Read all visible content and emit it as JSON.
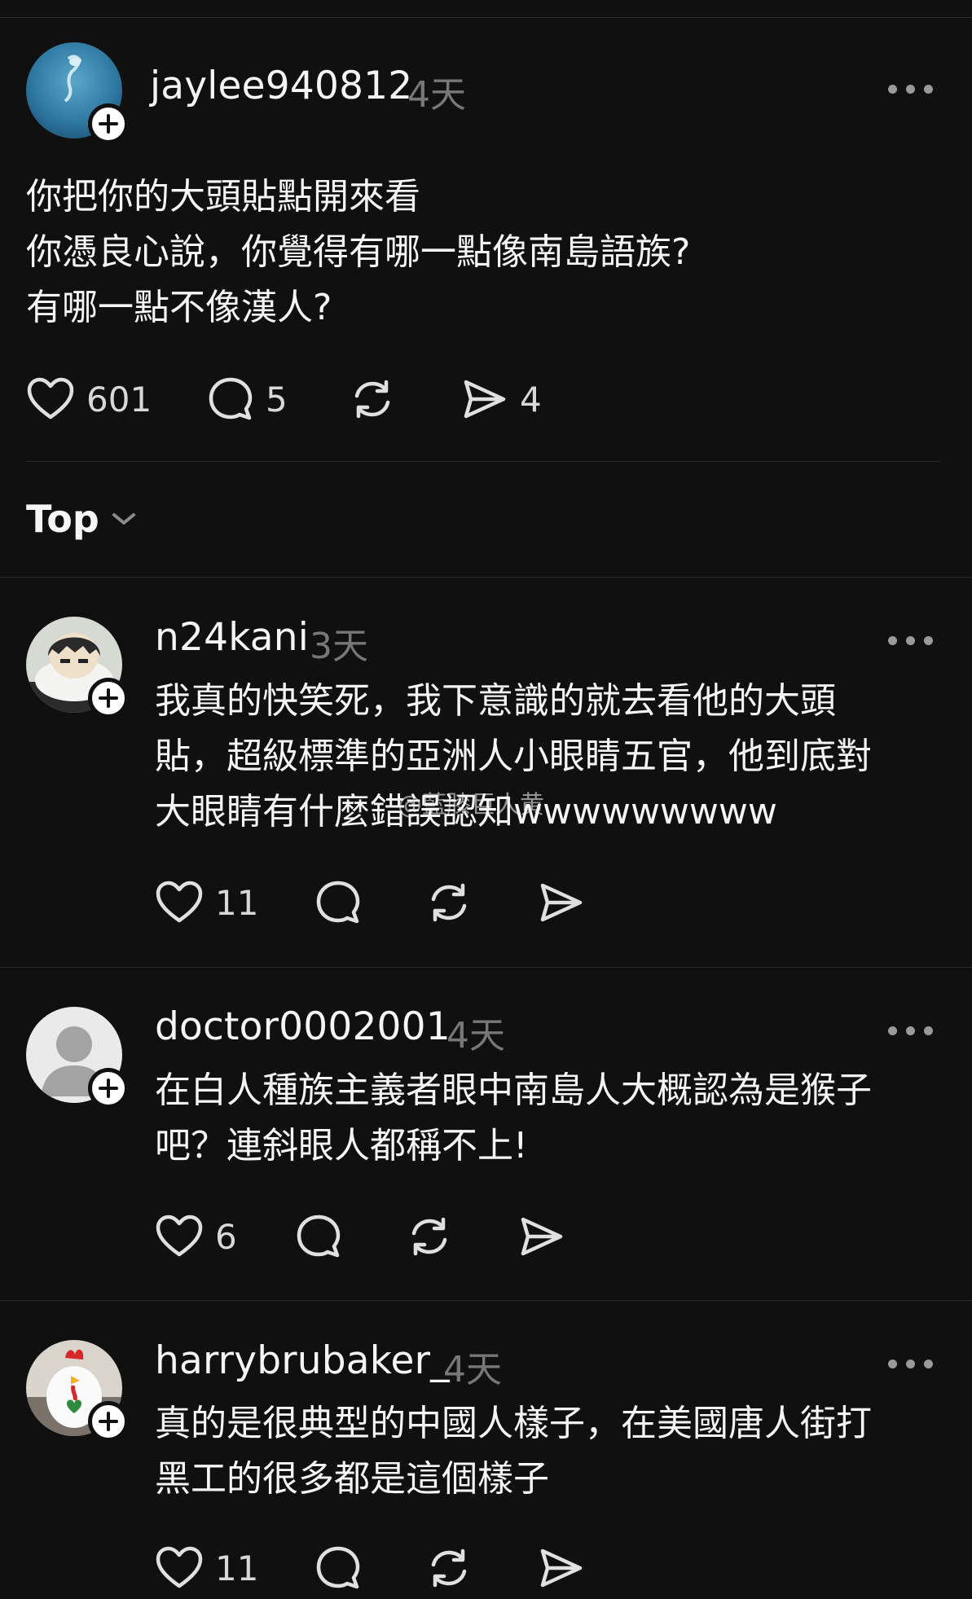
{
  "post": {
    "username": "jaylee940812",
    "time": "4天",
    "lines": [
      "你把你的大頭貼點開來看",
      "你憑良心說，你覺得有哪一點像南島語族?",
      "有哪一點不像漢人?"
    ],
    "likes": "601",
    "comments": "5",
    "shares": "4"
  },
  "sort": {
    "label": "Top"
  },
  "watermark": "@藍膝巨人黄",
  "replies": [
    {
      "username": "n24kani",
      "time": "3天",
      "lines": [
        "我真的快笑死，我下意識的就去看他的大頭",
        "貼，超級標準的亞洲人小眼睛五官，他到底對",
        "大眼睛有什麼錯誤認知wwwwwwwww"
      ],
      "likes": "11"
    },
    {
      "username": "doctor0002001",
      "time": "4天",
      "lines": [
        "在白人種族主義者眼中南島人大概認為是猴子",
        "吧？連斜眼人都稱不上!"
      ],
      "likes": "6"
    },
    {
      "username": "harrybrubaker_",
      "time": "4天",
      "lines": [
        "真的是很典型的中國人樣子，在美國唐人街打",
        "黑工￼的很多都是這個樣子"
      ],
      "likes": "11"
    }
  ],
  "colors": {
    "background": "#101010",
    "text": "#f3f5f7",
    "muted": "#777777",
    "divider": "#2a2a2a"
  }
}
